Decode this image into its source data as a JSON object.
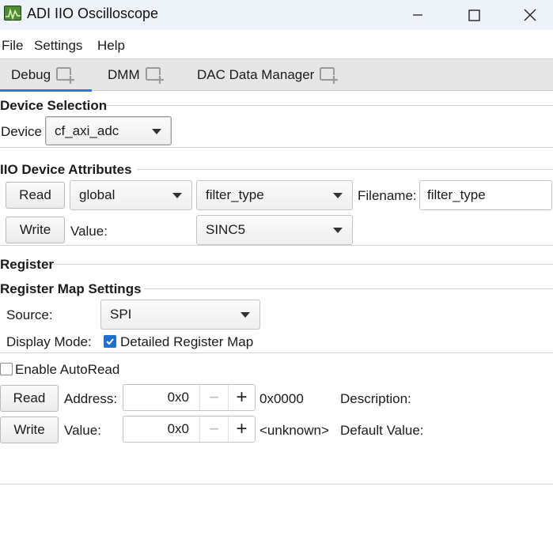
{
  "window": {
    "title": "ADI IIO Oscilloscope",
    "app_icon": "oscilloscope-app-icon",
    "controls": [
      "minimize-icon",
      "maximize-icon",
      "close-icon"
    ]
  },
  "menu": {
    "file": "File",
    "settings": "Settings",
    "help": "Help"
  },
  "tabs": [
    {
      "label": "Debug",
      "active": true,
      "icon": "add-tab-icon"
    },
    {
      "label": "DMM",
      "active": false,
      "icon": "add-tab-icon"
    },
    {
      "label": "DAC Data Manager",
      "active": false,
      "icon": "add-tab-icon"
    }
  ],
  "device_selection": {
    "title": "Device Selection",
    "device_label": "Device",
    "device_value": "cf_axi_adc"
  },
  "iio_attributes": {
    "title": "IIO Device Attributes",
    "read_label": "Read",
    "write_label": "Write",
    "channel_value": "global",
    "attribute_value": "filter_type",
    "filename_label": "Filename:",
    "filename_value": "filter_type",
    "value_label": "Value:",
    "value_value": "SINC5"
  },
  "register": {
    "title": "Register",
    "map_settings_title": "Register Map Settings",
    "source_label": "Source:",
    "source_value": "SPI",
    "display_mode_label": "Display Mode:",
    "detailed_map_label": "Detailed Register Map",
    "detailed_map_checked": true,
    "auto_read_label": "Enable AutoRead",
    "auto_read_checked": false,
    "read_label": "Read",
    "write_label": "Write",
    "address_label": "Address:",
    "address_value": "0x0",
    "address_hex": "0x0000",
    "description_label": "Description:",
    "value_label": "Value:",
    "value_value": "0x0",
    "value_text": "<unknown>",
    "default_value_label": "Default Value:",
    "spin_minus": "−",
    "spin_plus": "+"
  },
  "colors": {
    "accent": "#2a7bd4",
    "checkbox_checked": "#1f6fd0",
    "titlebar_bg": "#eef3fa",
    "tabbar_bg": "#e6e6e6"
  }
}
